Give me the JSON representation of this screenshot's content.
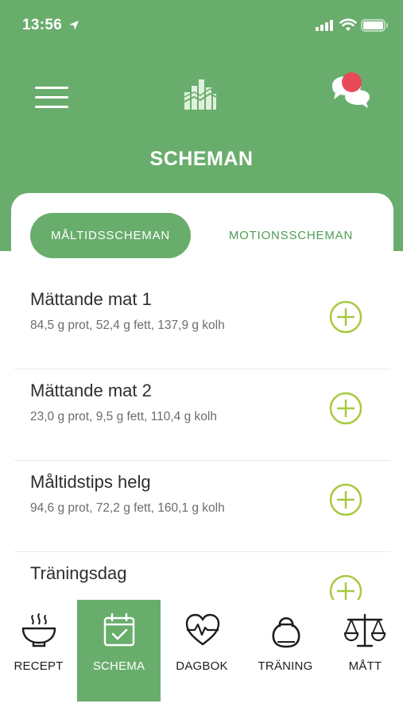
{
  "status_bar": {
    "time": "13:56"
  },
  "header": {
    "title": "SCHEMAN",
    "menu_icon": "hamburger-menu-icon",
    "logo_icon": "app-logo-bars-icon",
    "chat_icon": "chat-bubbles-icon",
    "accent_color": "#69ad6c",
    "notification_color": "#e94a5a"
  },
  "tabs": [
    {
      "label": "MÅLTIDSSCHEMAN",
      "active": true
    },
    {
      "label": "MOTIONSSCHEMAN",
      "active": false
    }
  ],
  "schedules": [
    {
      "title": "Mättande mat 1",
      "nutrition": "84,5 g prot, 52,4 g fett, 137,9 g kolh"
    },
    {
      "title": "Mättande mat 2",
      "nutrition": "23,0 g prot, 9,5 g fett, 110,4 g kolh"
    },
    {
      "title": "Måltidstips helg",
      "nutrition": "94,6 g prot, 72,2 g fett, 160,1 g kolh"
    },
    {
      "title": "Träningsdag",
      "nutrition": ""
    }
  ],
  "add_icon": "plus-circle-icon",
  "add_icon_color": "#a8c940",
  "bottom_nav": [
    {
      "label": "RECEPT",
      "icon": "bowl-icon",
      "active": false
    },
    {
      "label": "SCHEMA",
      "icon": "calendar-check-icon",
      "active": true
    },
    {
      "label": "DAGBOK",
      "icon": "heart-pulse-icon",
      "active": false
    },
    {
      "label": "TRÄNING",
      "icon": "kettlebell-icon",
      "active": false
    },
    {
      "label": "MÅTT",
      "icon": "scale-icon",
      "active": false
    }
  ]
}
